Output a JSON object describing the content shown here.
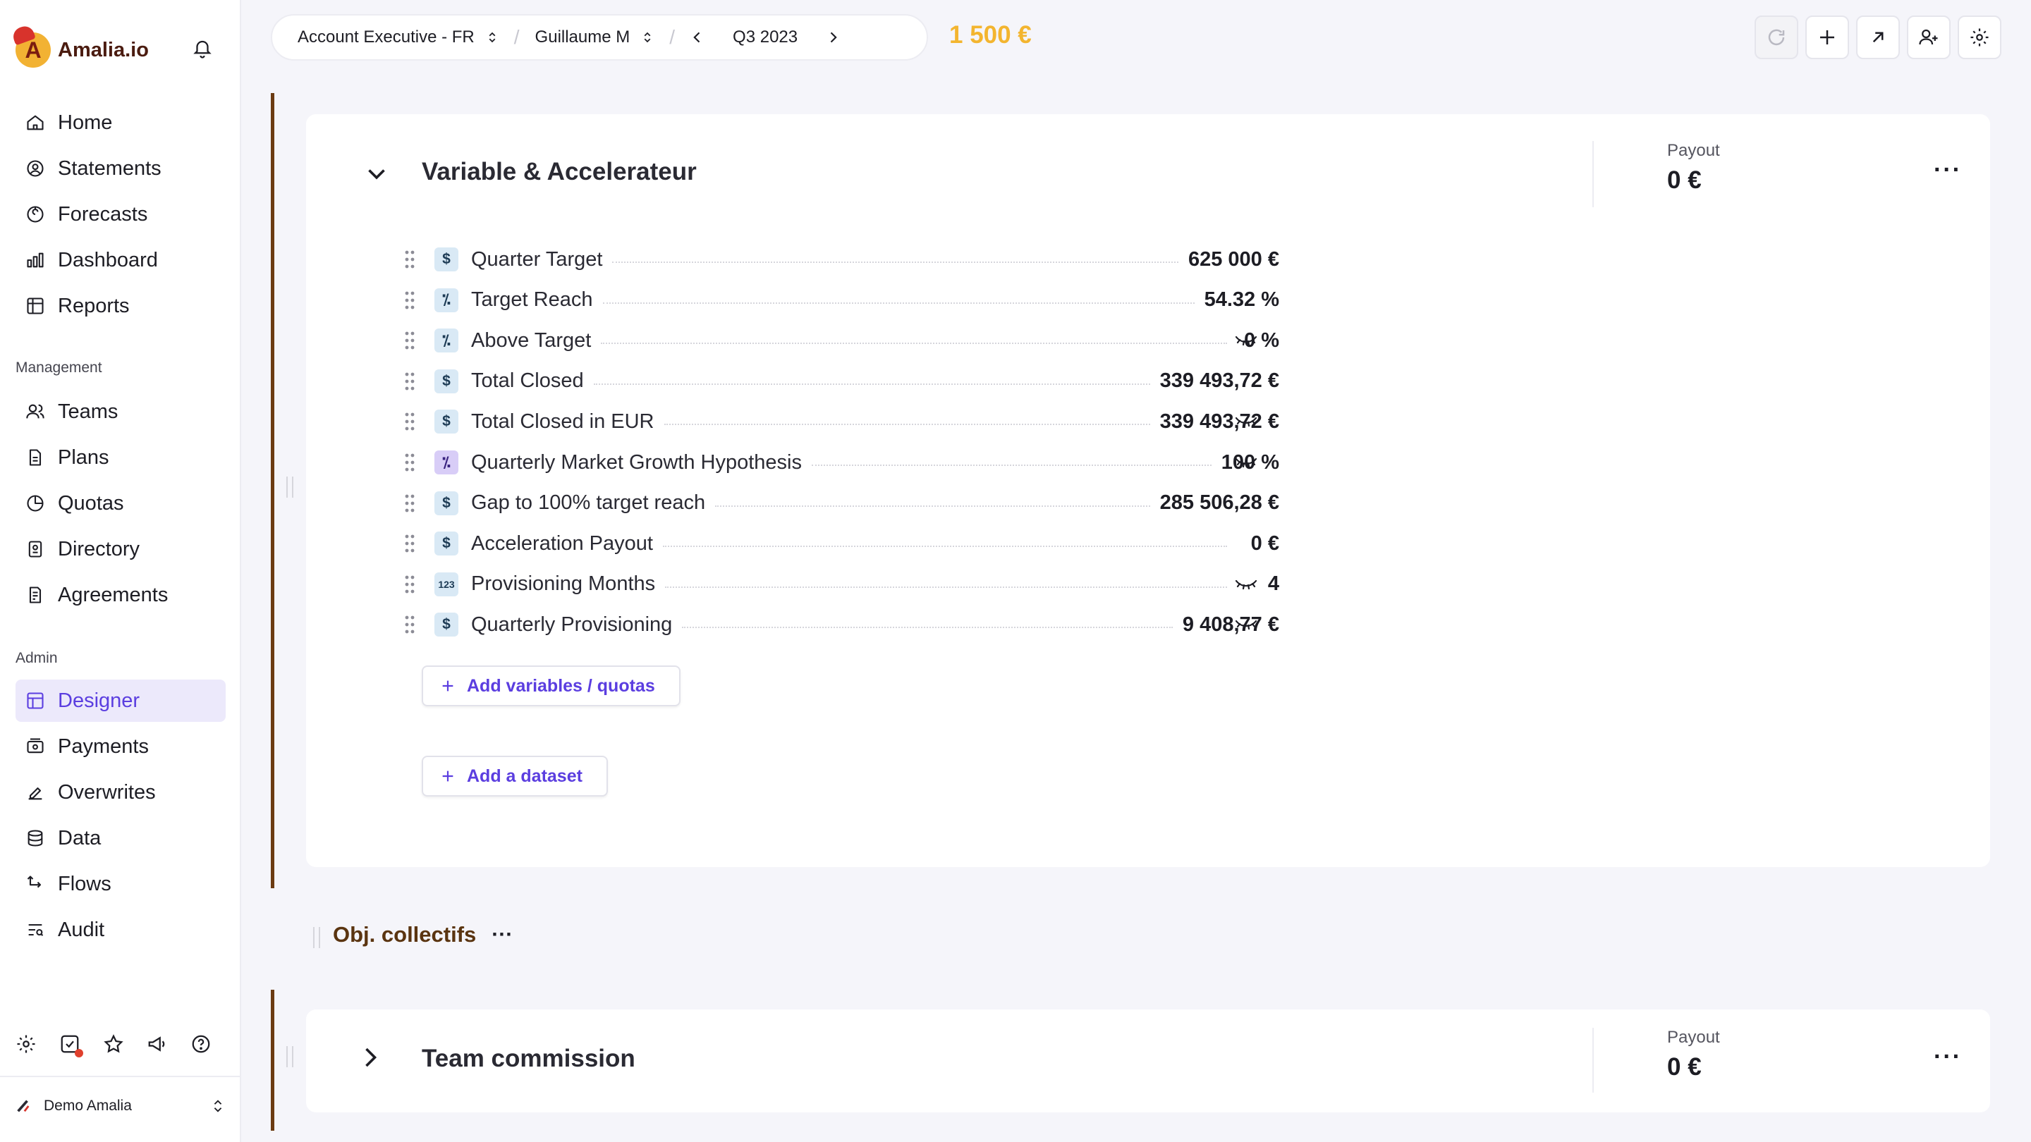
{
  "app": {
    "logo_text": "Amalia.io",
    "logo_letter": "A"
  },
  "sidebar": {
    "main": [
      {
        "label": "Home",
        "icon": "home-icon"
      },
      {
        "label": "Statements",
        "icon": "user-circle-icon"
      },
      {
        "label": "Forecasts",
        "icon": "forecast-icon"
      },
      {
        "label": "Dashboard",
        "icon": "chart-icon"
      },
      {
        "label": "Reports",
        "icon": "table-icon"
      }
    ],
    "management_label": "Management",
    "management": [
      {
        "label": "Teams",
        "icon": "users-icon"
      },
      {
        "label": "Plans",
        "icon": "document-icon"
      },
      {
        "label": "Quotas",
        "icon": "quota-icon"
      },
      {
        "label": "Directory",
        "icon": "directory-icon"
      },
      {
        "label": "Agreements",
        "icon": "agreement-icon"
      }
    ],
    "admin_label": "Admin",
    "admin": [
      {
        "label": "Designer",
        "icon": "designer-icon",
        "active": true
      },
      {
        "label": "Payments",
        "icon": "payments-icon"
      },
      {
        "label": "Overwrites",
        "icon": "overwrite-icon"
      },
      {
        "label": "Data",
        "icon": "database-icon"
      },
      {
        "label": "Flows",
        "icon": "flows-icon"
      },
      {
        "label": "Audit",
        "icon": "audit-icon"
      }
    ],
    "user": "Demo Amalia"
  },
  "topbar": {
    "plan": "Account Executive - FR",
    "user": "Guillaume M",
    "period": "Q3 2023",
    "payout": "1 500 €"
  },
  "rules": [
    {
      "title": "Variable & Accelerateur",
      "payout_label": "Payout",
      "payout": "0 €",
      "more": "···",
      "rows": [
        {
          "label": "Quarter Target",
          "value": "625 000 €",
          "type": "$",
          "hidden": false
        },
        {
          "label": "Target Reach",
          "value": "54.32 %",
          "type": "%",
          "hidden": false
        },
        {
          "label": "Above Target",
          "value": "0 %",
          "type": "%",
          "hidden": true
        },
        {
          "label": "Total Closed",
          "value": "339 493,72 €",
          "type": "$",
          "hidden": false
        },
        {
          "label": "Total Closed in EUR",
          "value": "339 493,72 €",
          "type": "$",
          "hidden": true
        },
        {
          "label": "Quarterly Market Growth Hypothesis",
          "value": "100 %",
          "type": "%p",
          "hidden": true
        },
        {
          "label": "Gap to 100% target reach",
          "value": "285 506,28 €",
          "type": "$",
          "hidden": false
        },
        {
          "label": "Acceleration Payout",
          "value": "0 €",
          "type": "$",
          "hidden": false
        },
        {
          "label": "Provisioning Months",
          "value": "4",
          "type": "123",
          "hidden": true
        },
        {
          "label": "Quarterly Provisioning",
          "value": "9 408,77 €",
          "type": "$",
          "hidden": true
        }
      ],
      "add_variables": "Add variables / quotas",
      "add_dataset": "Add a dataset"
    },
    {
      "group": "Obj. collectifs",
      "title": "Team commission",
      "payout_label": "Payout",
      "payout": "0 €",
      "more": "···"
    }
  ]
}
